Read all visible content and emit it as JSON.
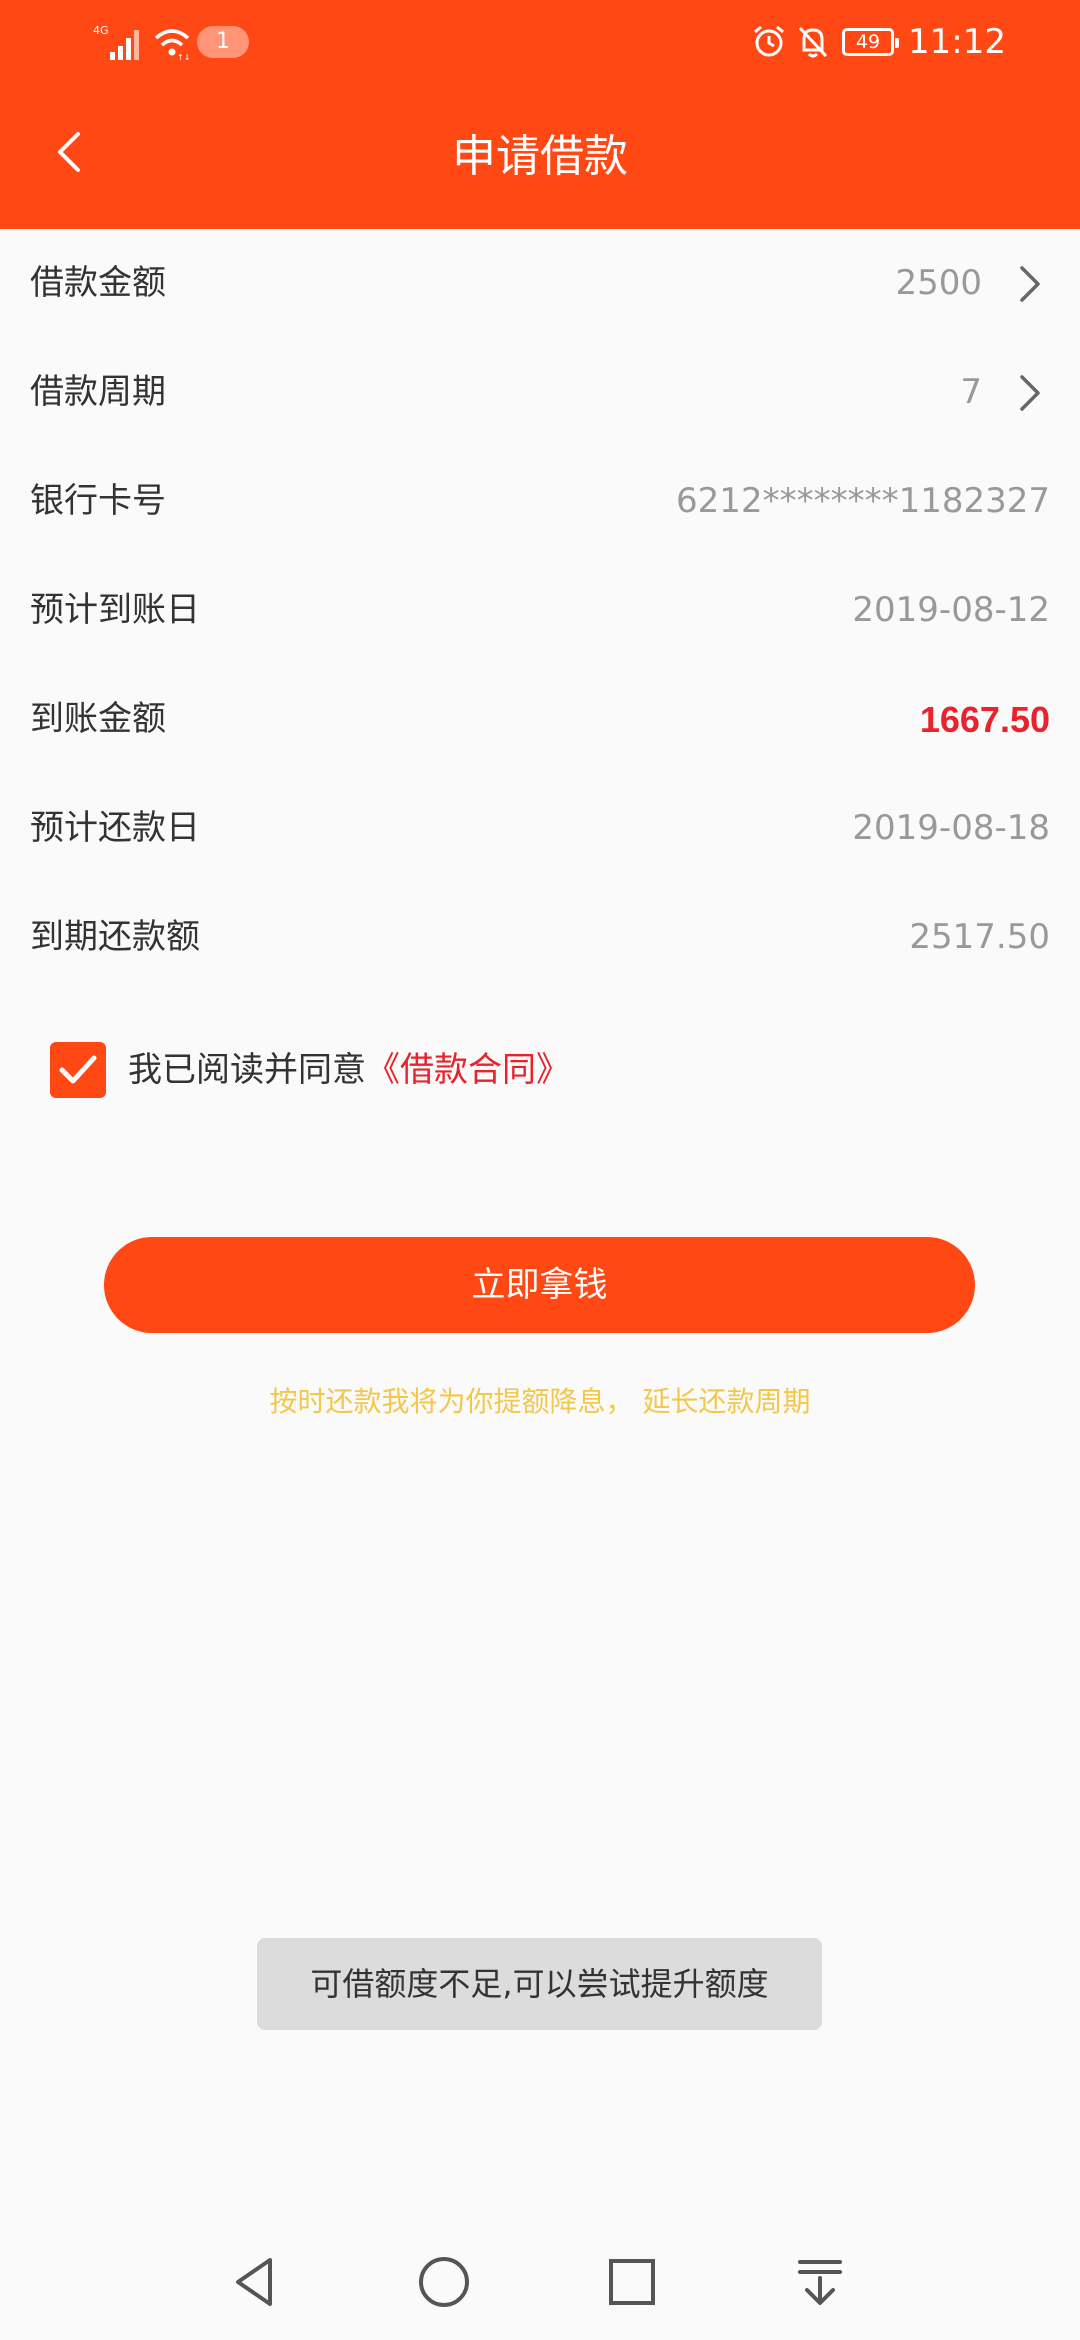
{
  "status_bar": {
    "network": "4G",
    "notification_count": "1",
    "battery": "49",
    "time": "11:12"
  },
  "header": {
    "title": "申请借款",
    "background": "#ff4813"
  },
  "rows": [
    {
      "label": "借款金额",
      "value": "2500",
      "has_arrow": true
    },
    {
      "label": "借款周期",
      "value": "7",
      "has_arrow": true
    },
    {
      "label": "银行卡号",
      "value": "6212********1182327",
      "has_arrow": false
    },
    {
      "label": "预计到账日",
      "value": "2019-08-12",
      "has_arrow": false
    },
    {
      "label": "到账金额",
      "value": "1667.50",
      "has_arrow": false,
      "highlight_color": "#e8232b"
    },
    {
      "label": "预计还款日",
      "value": "2019-08-18",
      "has_arrow": false
    },
    {
      "label": "到期还款额",
      "value": "2517.50",
      "has_arrow": false
    }
  ],
  "agreement": {
    "checked": true,
    "text": "我已阅读并同意",
    "link_text": "《借款合同》"
  },
  "cta": {
    "label": "立即拿钱"
  },
  "hint": "按时还款我将为你提额降息， 延长还款周期",
  "toast": "可借额度不足,可以尝试提升额度",
  "nav_bar": {
    "icons": [
      "back-triangle-icon",
      "home-circle-icon",
      "recents-square-icon",
      "notification-pull-down-icon"
    ]
  }
}
